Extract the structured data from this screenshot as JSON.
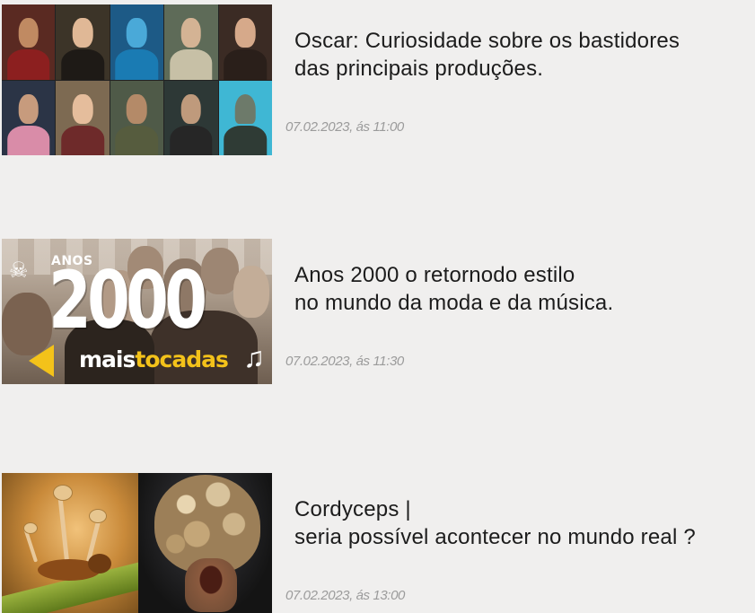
{
  "articles": [
    {
      "title_lines": [
        "Oscar: Curiosidade sobre os bastidores",
        "das principais produções."
      ],
      "date": "07.02.2023, ás 11:00",
      "thumbnail": {
        "kind": "movie-collage"
      }
    },
    {
      "title_lines": [
        "Anos 2000 o retornodo estilo",
        "no mundo da moda e da música."
      ],
      "date": "07.02.2023, ás 11:30",
      "thumbnail": {
        "kind": "music-poster",
        "small_text": "ANOS",
        "big_text": "2000",
        "brand_white": "mais",
        "brand_yellow": "tocadas"
      }
    },
    {
      "title_lines": [
        "Cordyceps |",
        "seria possível acontecer no mundo real ?"
      ],
      "date": "07.02.2023, ás 13:00",
      "thumbnail": {
        "kind": "fungus-split"
      }
    }
  ],
  "colors": {
    "background": "#f0efee",
    "title": "#1c1c1c",
    "date": "#9b9b9b",
    "brand_yellow": "#f3c21a"
  }
}
